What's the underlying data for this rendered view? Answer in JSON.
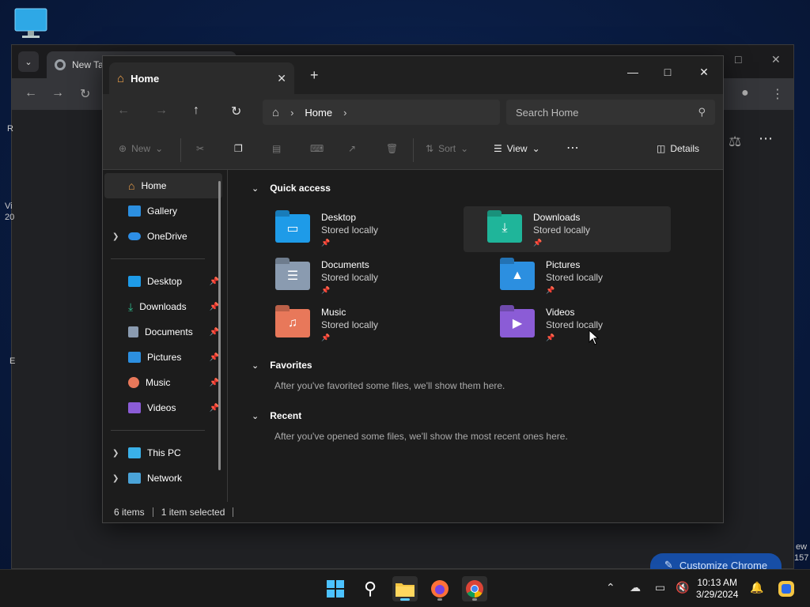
{
  "chrome": {
    "tab_title": "New Tab",
    "side_left_1": "R",
    "side_left_2": "Vi",
    "side_left_3": "20",
    "side_left_4": "E",
    "side_right_1": "ew",
    "side_right_2": "157",
    "customize_label": "Customize Chrome"
  },
  "explorer": {
    "tab_label": "Home",
    "breadcrumb": "Home",
    "search_placeholder": "Search Home",
    "commands": {
      "new": "New",
      "sort": "Sort",
      "view": "View",
      "details": "Details"
    },
    "sidebar": {
      "home": "Home",
      "gallery": "Gallery",
      "onedrive": "OneDrive",
      "desktop": "Desktop",
      "downloads": "Downloads",
      "documents": "Documents",
      "pictures": "Pictures",
      "music": "Music",
      "videos": "Videos",
      "thispc": "This PC",
      "network": "Network"
    },
    "sections": {
      "quick_access": "Quick access",
      "favorites": "Favorites",
      "favorites_empty": "After you've favorited some files, we'll show them here.",
      "recent": "Recent",
      "recent_empty": "After you've opened some files, we'll show the most recent ones here."
    },
    "quick_access": [
      {
        "name": "Desktop",
        "sub": "Stored locally"
      },
      {
        "name": "Downloads",
        "sub": "Stored locally"
      },
      {
        "name": "Documents",
        "sub": "Stored locally"
      },
      {
        "name": "Pictures",
        "sub": "Stored locally"
      },
      {
        "name": "Music",
        "sub": "Stored locally"
      },
      {
        "name": "Videos",
        "sub": "Stored locally"
      }
    ],
    "status": {
      "items": "6 items",
      "selected": "1 item selected"
    }
  },
  "taskbar": {
    "time": "10:13 AM",
    "date": "3/29/2024"
  },
  "colors": {
    "accent": "#60cdff",
    "desktop_folder": "#1e9be8",
    "downloads_folder": "#1fb59a",
    "documents_folder": "#8a9bb0",
    "pictures_folder": "#2c8fe0",
    "music_folder": "#e8785a",
    "videos_folder": "#8b5cd6"
  }
}
